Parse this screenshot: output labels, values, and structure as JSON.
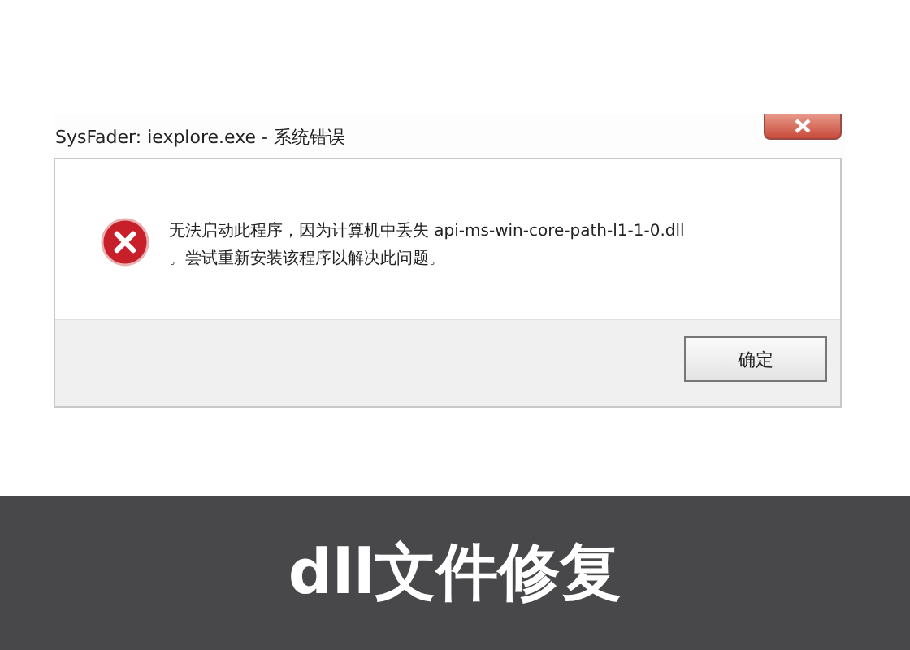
{
  "dialog": {
    "title": "SysFader: iexplore.exe - 系统错误",
    "message_lines": [
      "无法启动此程序，因为计算机中丢失 api-ms-win-core-path-l1-1-0.dll",
      "。尝试重新安装该程序以解决此问题。"
    ],
    "buttons": [
      "确定"
    ]
  },
  "caption": "dll文件修复"
}
